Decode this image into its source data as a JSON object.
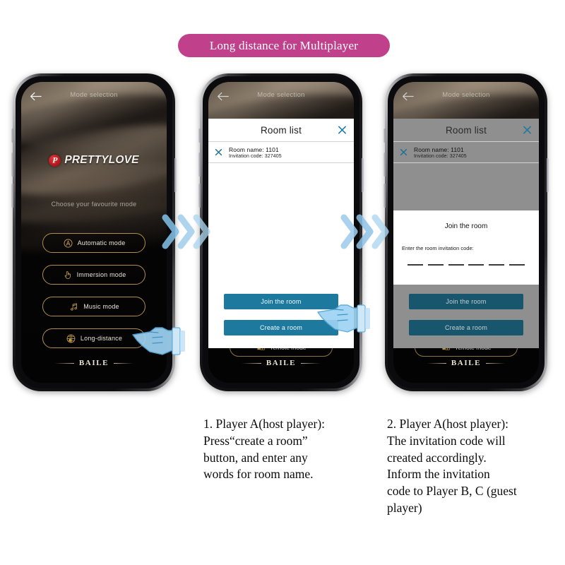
{
  "banner": {
    "text": "Long distance for Multiplayer",
    "color": "#c0408b"
  },
  "app": {
    "header_title": "Mode selection",
    "back_icon": "back-arrow-icon",
    "brand": {
      "badge_letter": "P",
      "name": "PRETTYLOVE",
      "badge_color": "#c2181d"
    },
    "choose_prompt": "Choose your favourite mode",
    "modes": [
      {
        "label": "Automatic mode",
        "icon": "automatic-mode-icon"
      },
      {
        "label": "Immersion mode",
        "icon": "hand-touch-icon"
      },
      {
        "label": "Music mode",
        "icon": "music-note-icon"
      },
      {
        "label": "Long-distance",
        "icon": "globe-icon"
      }
    ],
    "remote_mode_label": "remote mode",
    "remote_mode_icon": "remote-control-icon",
    "footer_brand": "BAILE"
  },
  "dialog": {
    "title": "Room list",
    "close_icon": "close-icon",
    "room": {
      "close_icon": "close-icon",
      "name_line": "Room name: 1101",
      "code_line": "Invitation code:  327405"
    },
    "buttons": {
      "join": "Join the room",
      "create": "Create a room"
    },
    "accent_color": "#1d7a9e",
    "dimmed_accent_color": "#18566e",
    "dim_overlay_color": "#8f8f8f"
  },
  "join_sheet": {
    "title": "Join the room",
    "prompt": "Enter the room invitation code:",
    "code_slots": 6
  },
  "flow": {
    "chevron_icon": "chevron-right-icon",
    "chevron_color": "#8fc4e8",
    "hand_icon": "pointing-hand-icon"
  },
  "captions": {
    "step1": "1. Player A(host player):\nPress“create a room”\nbutton, and enter any\nwords for room name.",
    "step2": "2. Player A(host player):\nThe invitation code will\ncreated accordingly.\nInform the invitation\ncode to Player B, C (guest\nplayer)"
  }
}
